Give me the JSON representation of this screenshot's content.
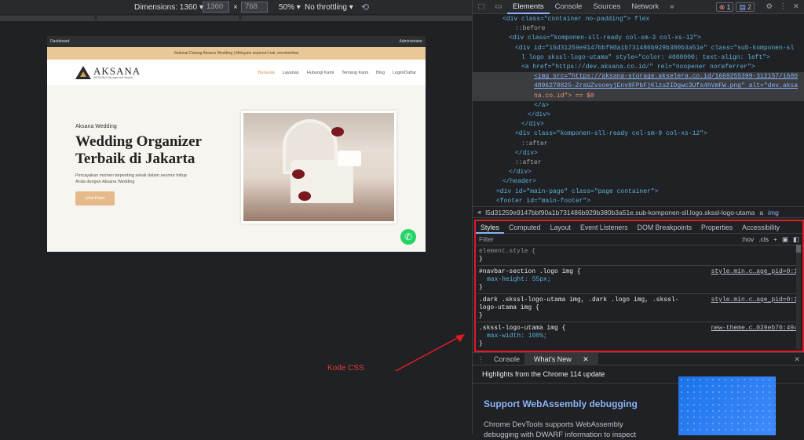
{
  "device_toolbar": {
    "dimensions_label": "Dimensions: 1360",
    "width": "1360",
    "times": "×",
    "height": "768",
    "zoom": "50%",
    "throttle": "No throttling"
  },
  "site": {
    "admin_left": "Dashboard",
    "admin_right": "Administrator",
    "announcement": "Selamat Datang Aksana Wedding | Melayani sepenuh hati, memberikan",
    "logo_name": "AKSANA",
    "logo_tagline": "WEDDING Management System",
    "menu": [
      "Beranda",
      "Layanan",
      "Hubungi Kami",
      "Tentang Kami",
      "Blog",
      "Login/Daftar"
    ],
    "hero_sub": "Aksana Wedding",
    "hero_title": "Wedding Organizer Terbaik di Jakarta",
    "hero_desc": "Percayakan momen terpenting sekali dalam seumur hidup Anda dengan Aksana Wedding",
    "hero_button": "Lihat Paket"
  },
  "annotation": "Kode CSS",
  "devtools": {
    "tabs": [
      "Elements",
      "Console",
      "Sources",
      "Network"
    ],
    "errors": "1",
    "messages": "2",
    "tree": [
      "<div class=\"container no-padding\"> flex",
      "::before",
      "<div class=\"komponen-sll-ready col-sm-3 col-xs-12\">",
      "<div id=\"15d31259e9147bbf90a1b731486b929b380b3a51e\" class=\"sub-komponen-sl",
      "l logo skssl-logo-utama\" style=\"color: #000000; text-align: left\">",
      "<a href=\"https://dev.aksana.co.id/\" rel=\"noopener noreferrer\">",
      "<img src=\"https://aksana-storage.akselera.co.id/1669255399-312157/1680",
      "4896278825-ZraUZvsoeyjEnv8FPbFjKlzu2IDgwc3Ufs4hVmFW.png\" alt=\"dev.aksa",
      "na.co.id\"> == $0",
      "</a>",
      "</div>",
      "</div>",
      "<div class=\"komponen-sll-ready col-sm-9 col-xs-12\">",
      "::after",
      "</div>",
      "::after",
      "</div>",
      "</header>",
      "<div id=\"main-page\" class=\"page container\">",
      "<footer id=\"main-footer\">"
    ],
    "breadcrumb": "l5d31259e9147bbf90a1b731486b929b380b3a51e.sub-komponen-sll.logo.skssl-logo-utama",
    "breadcrumb_tail": "a",
    "breadcrumb_last": "img",
    "styles_tabs": [
      "Styles",
      "Computed",
      "Layout",
      "Event Listeners",
      "DOM Breakpoints",
      "Properties",
      "Accessibility"
    ],
    "filter_placeholder": "Filter",
    "filter_hov": ":hov",
    "filter_cls": ".cls",
    "rules": [
      {
        "selector": "element.style {",
        "src": "",
        "props": []
      },
      {
        "selector": "#navbar-section .logo img {",
        "src": "style.min.c…age_pid=0:1",
        "props": [
          "max-height: 55px;"
        ]
      },
      {
        "selector": ".dark .skssl-logo-utama img, .dark .logo img, .skssl-logo-utama img {",
        "src": "style.min.c…age_pid=0:1",
        "props": []
      },
      {
        "selector": ".skssl-logo-utama img {",
        "src": "new-theme.c…029eb70:494",
        "props": [
          "max-width: 100%;"
        ]
      }
    ],
    "drawer_tabs": [
      "Console",
      "What's New"
    ],
    "highlights": "Highlights from the Chrome 114 update",
    "feature_title": "Support WebAssembly debugging",
    "feature_desc": "Chrome DevTools supports WebAssembly debugging with DWARF information to inspect"
  }
}
